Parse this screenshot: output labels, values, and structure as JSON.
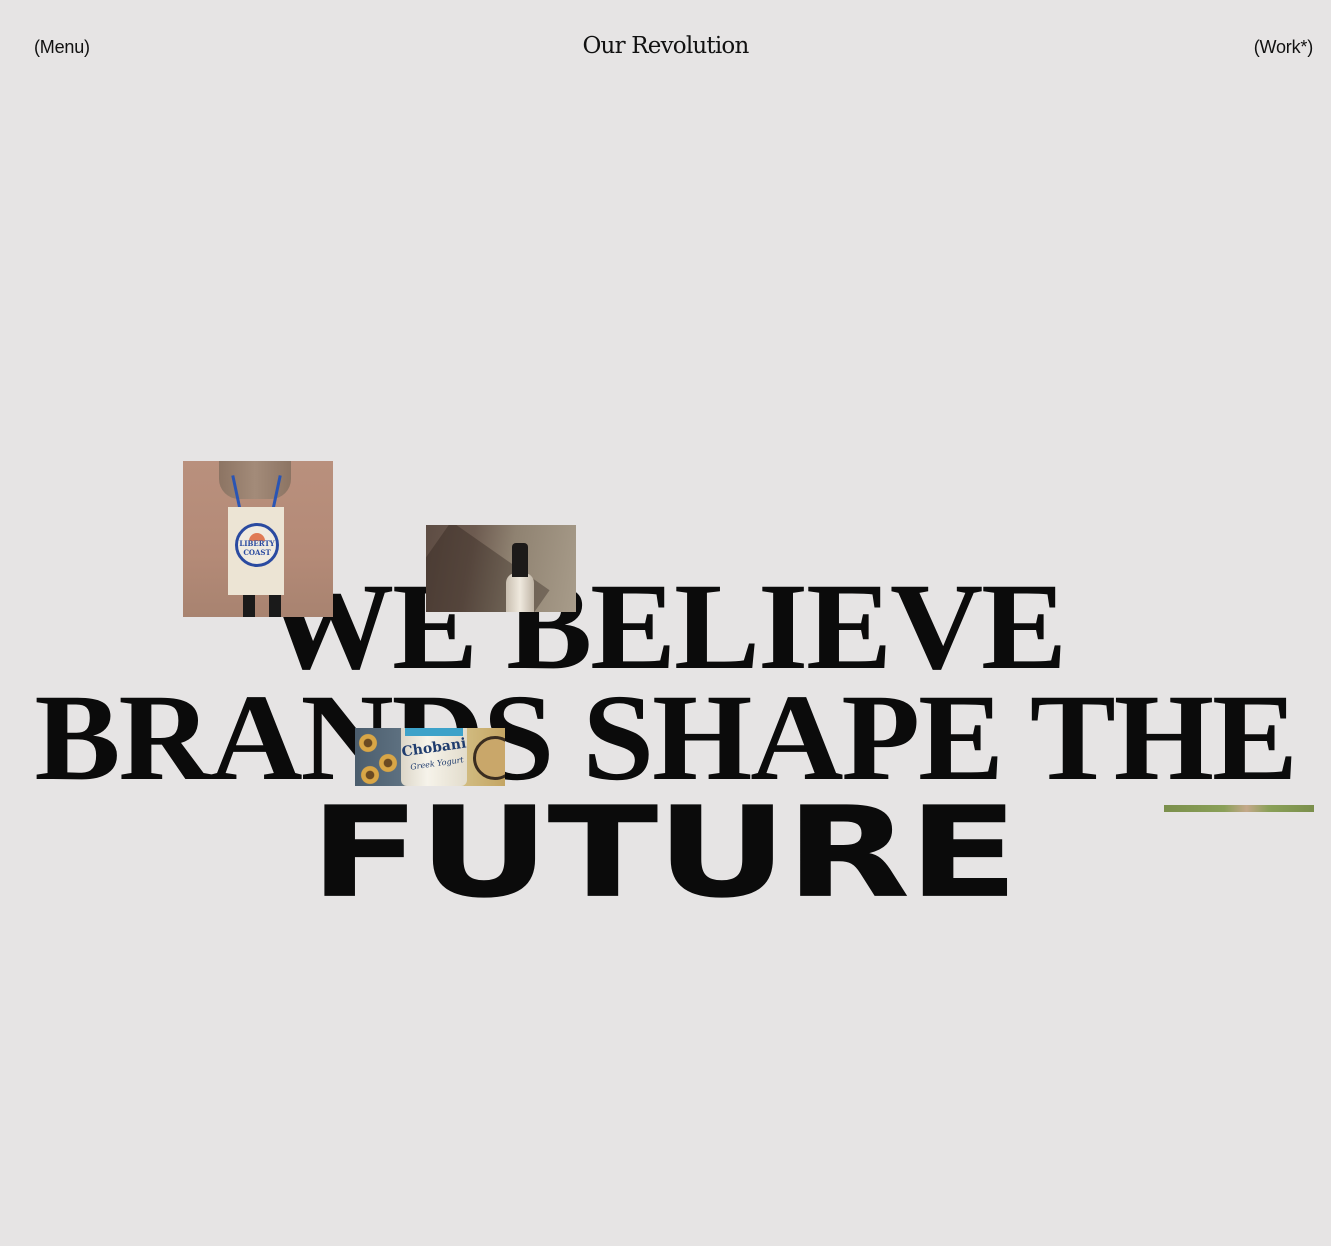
{
  "header": {
    "menu_label": "(Menu)",
    "title": "Our Revolution",
    "work_label": "(Work*)"
  },
  "hero": {
    "line_1": "WE BELIEVE",
    "line_2": "BRANDS SHAPE THE",
    "line_3": "FUTURE"
  },
  "images": {
    "tote_badge_text": "LIBERTY COAST",
    "yogurt_brand_text": "Chobani",
    "yogurt_sub_text": "Greek Yogurt"
  },
  "colors": {
    "background": "#e6e4e4",
    "text": "#0b0b0b"
  }
}
